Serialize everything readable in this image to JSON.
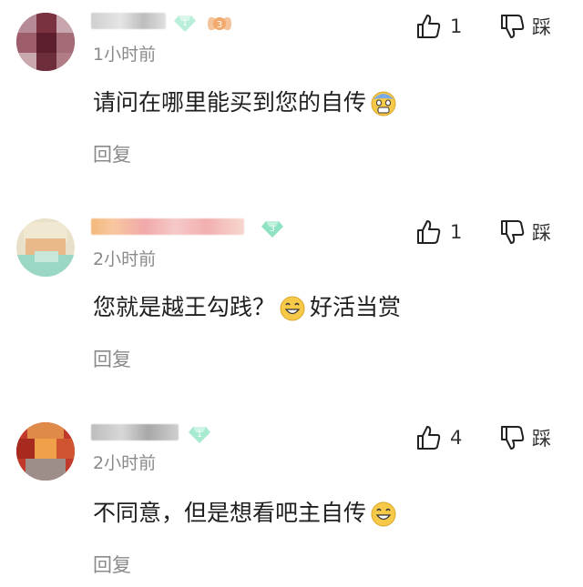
{
  "comments": [
    {
      "time": "1小时前",
      "text": "请问在哪里能买到您的自传",
      "text_after": "",
      "emoji": "fear-face",
      "reply_label": "回复",
      "likes": "1",
      "dislike_label": "踩",
      "level": "1",
      "badge": "3"
    },
    {
      "time": "2小时前",
      "text": "您就是越王勾践？",
      "text_after": "好活当赏",
      "emoji": "grin-face",
      "reply_label": "回复",
      "likes": "1",
      "dislike_label": "踩",
      "level": "3"
    },
    {
      "time": "2小时前",
      "text": "不同意，但是想看吧主自传",
      "text_after": "",
      "emoji": "grin-face",
      "reply_label": "回复",
      "likes": "4",
      "dislike_label": "踩",
      "level": "1"
    }
  ],
  "colors": {
    "gem": "#8fe3c3",
    "gem_dark": "#5fc9a3",
    "gray_text": "#8a8a8a",
    "emoji_yellow": "#f7c948"
  }
}
